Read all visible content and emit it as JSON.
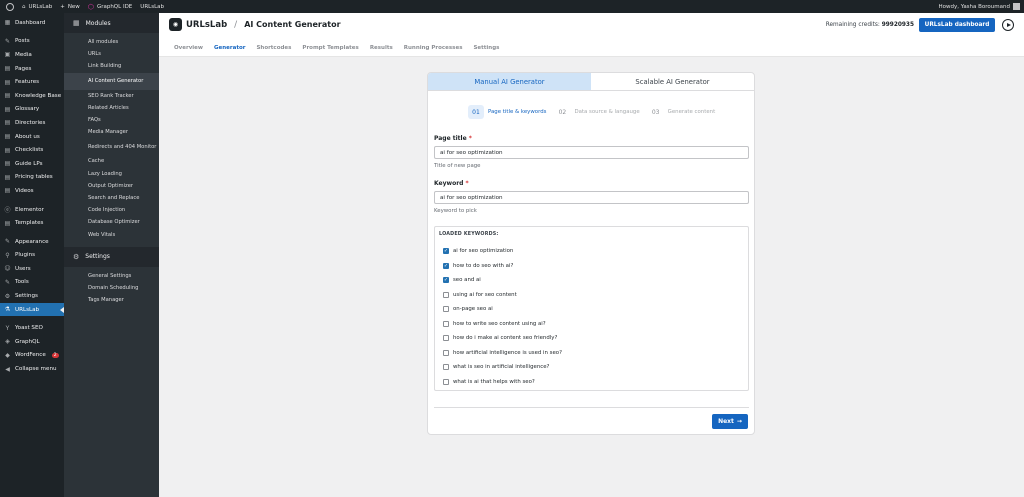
{
  "adminbar": {
    "site": "URLsLab",
    "new": "New",
    "graphql": "GraphQL IDE",
    "plugin": "URLsLab",
    "howdy": "Howdy, Yasha Boroumand"
  },
  "menu": {
    "items": [
      {
        "label": "Dashboard",
        "icon": "▦"
      },
      {
        "label": "Posts",
        "icon": "✎"
      },
      {
        "label": "Media",
        "icon": "▣"
      },
      {
        "label": "Pages",
        "icon": "▤"
      },
      {
        "label": "Features",
        "icon": "▤"
      },
      {
        "label": "Knowledge Base",
        "icon": "▤"
      },
      {
        "label": "Glossary",
        "icon": "▤"
      },
      {
        "label": "Directories",
        "icon": "▤"
      },
      {
        "label": "About us",
        "icon": "▤"
      },
      {
        "label": "Checklists",
        "icon": "▤"
      },
      {
        "label": "Guide LPs",
        "icon": "▤"
      },
      {
        "label": "Pricing tables",
        "icon": "▤"
      },
      {
        "label": "Videos",
        "icon": "▤"
      },
      {
        "label": "Elementor",
        "icon": "ⓔ"
      },
      {
        "label": "Templates",
        "icon": "▤"
      },
      {
        "label": "Appearance",
        "icon": "✎"
      },
      {
        "label": "Plugins",
        "icon": "⚲"
      },
      {
        "label": "Users",
        "icon": "☺"
      },
      {
        "label": "Tools",
        "icon": "✎"
      },
      {
        "label": "Settings",
        "icon": "⚙"
      },
      {
        "label": "URLsLab",
        "icon": "⚗"
      },
      {
        "label": "Yoast SEO",
        "icon": "Y"
      },
      {
        "label": "GraphQL",
        "icon": "◈"
      },
      {
        "label": "WordFence",
        "icon": "◆",
        "badge": "2"
      },
      {
        "label": "Collapse menu",
        "icon": "◀"
      }
    ]
  },
  "subsidebar": {
    "modules_title": "Modules",
    "modules": [
      "All modules",
      "URLs",
      "Link Building",
      "AI Content Generator",
      "SEO Rank Tracker",
      "Related Articles",
      "FAQs",
      "Media Manager",
      "Redirects and 404 Monitor",
      "Cache",
      "Lazy Loading",
      "Output Optimizer",
      "Search and Replace",
      "Code Injection",
      "Database Optimizer",
      "Web Vitals"
    ],
    "settings_title": "Settings",
    "settings": [
      "General Settings",
      "Domain Scheduling",
      "Tags Manager"
    ]
  },
  "header": {
    "brand": "URLsLab",
    "page_title": "AI Content Generator",
    "credits_label": "Remaining credits:",
    "credits_value": "99920935",
    "dashboard_button": "URLsLab dashboard",
    "tabs": [
      "Overview",
      "Generator",
      "Shortcodes",
      "Prompt Templates",
      "Results",
      "Running Processes",
      "Settings"
    ]
  },
  "generator": {
    "mode_tabs": [
      "Manual AI Generator",
      "Scalable AI Generator"
    ],
    "steps": [
      {
        "num": "01",
        "label": "Page title & keywords"
      },
      {
        "num": "02",
        "label": "Data source & langauge"
      },
      {
        "num": "03",
        "label": "Generate content"
      }
    ],
    "page_title": {
      "label": "Page title",
      "required": "*",
      "value": "ai for seo optimization",
      "help": "Title of new page"
    },
    "keyword": {
      "label": "Keyword",
      "required": "*",
      "value": "ai for seo optimization",
      "help": "Keyword to pick"
    },
    "loaded_keywords_title": "LOADED KEYWORDS:",
    "keywords": [
      {
        "text": "ai for seo optimization",
        "checked": true
      },
      {
        "text": "how to do seo with ai?",
        "checked": true
      },
      {
        "text": "seo and ai",
        "checked": true
      },
      {
        "text": "using ai for seo content",
        "checked": false
      },
      {
        "text": "on-page seo ai",
        "checked": false
      },
      {
        "text": "how to write seo content using ai?",
        "checked": false
      },
      {
        "text": "how do i make ai content seo friendly?",
        "checked": false
      },
      {
        "text": "how artificial intelligence is used in seo?",
        "checked": false
      },
      {
        "text": "what is seo in artificial intelligence?",
        "checked": false
      },
      {
        "text": "what is ai that helps with seo?",
        "checked": false
      }
    ],
    "next_button": "Next"
  },
  "colors": {
    "accent": "#1565c0",
    "admin_dark": "#1d2327",
    "active_menu": "#2271b1"
  }
}
